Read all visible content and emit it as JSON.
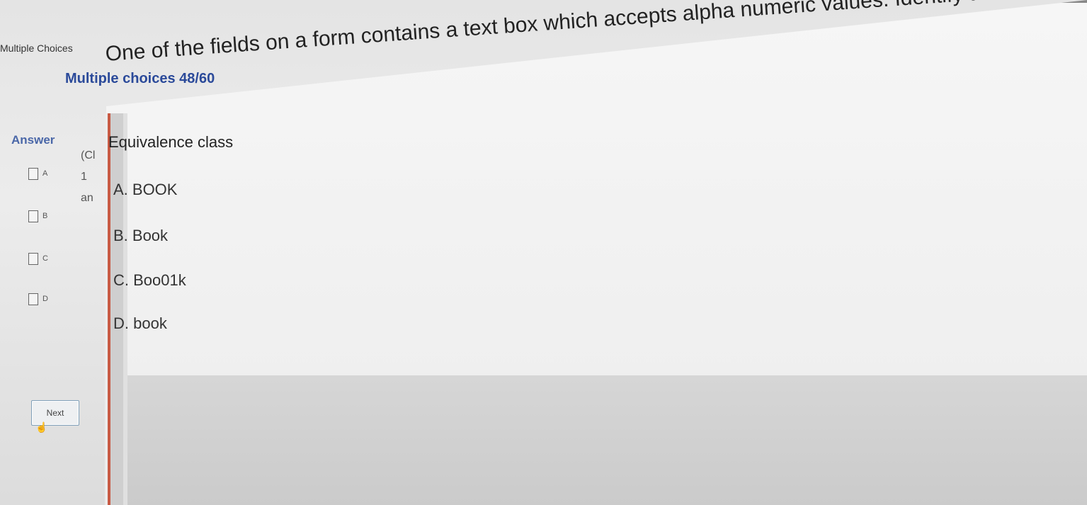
{
  "window": {
    "title": "Multiple Choices"
  },
  "header": {
    "progress_label": "Multiple choices 48/60"
  },
  "answer_panel": {
    "heading": "Answer",
    "options": [
      {
        "label": "A"
      },
      {
        "label": "B"
      },
      {
        "label": "C"
      },
      {
        "label": "D"
      }
    ],
    "next_label": "Next"
  },
  "gutter": {
    "lines": [
      "(Cl",
      "1",
      "an"
    ]
  },
  "question": {
    "line1": "One of the fields on a form contains a text box which accepts alpha numeric values. Identify the Valid",
    "line2": "Equivalence class",
    "choices": [
      {
        "text": "A. BOOK"
      },
      {
        "text": "B. Book"
      },
      {
        "text": "C. Boo01k"
      },
      {
        "text": "D. book"
      }
    ]
  },
  "colors": {
    "heading": "#2b4a9a",
    "accent_bar": "#c85a44"
  }
}
